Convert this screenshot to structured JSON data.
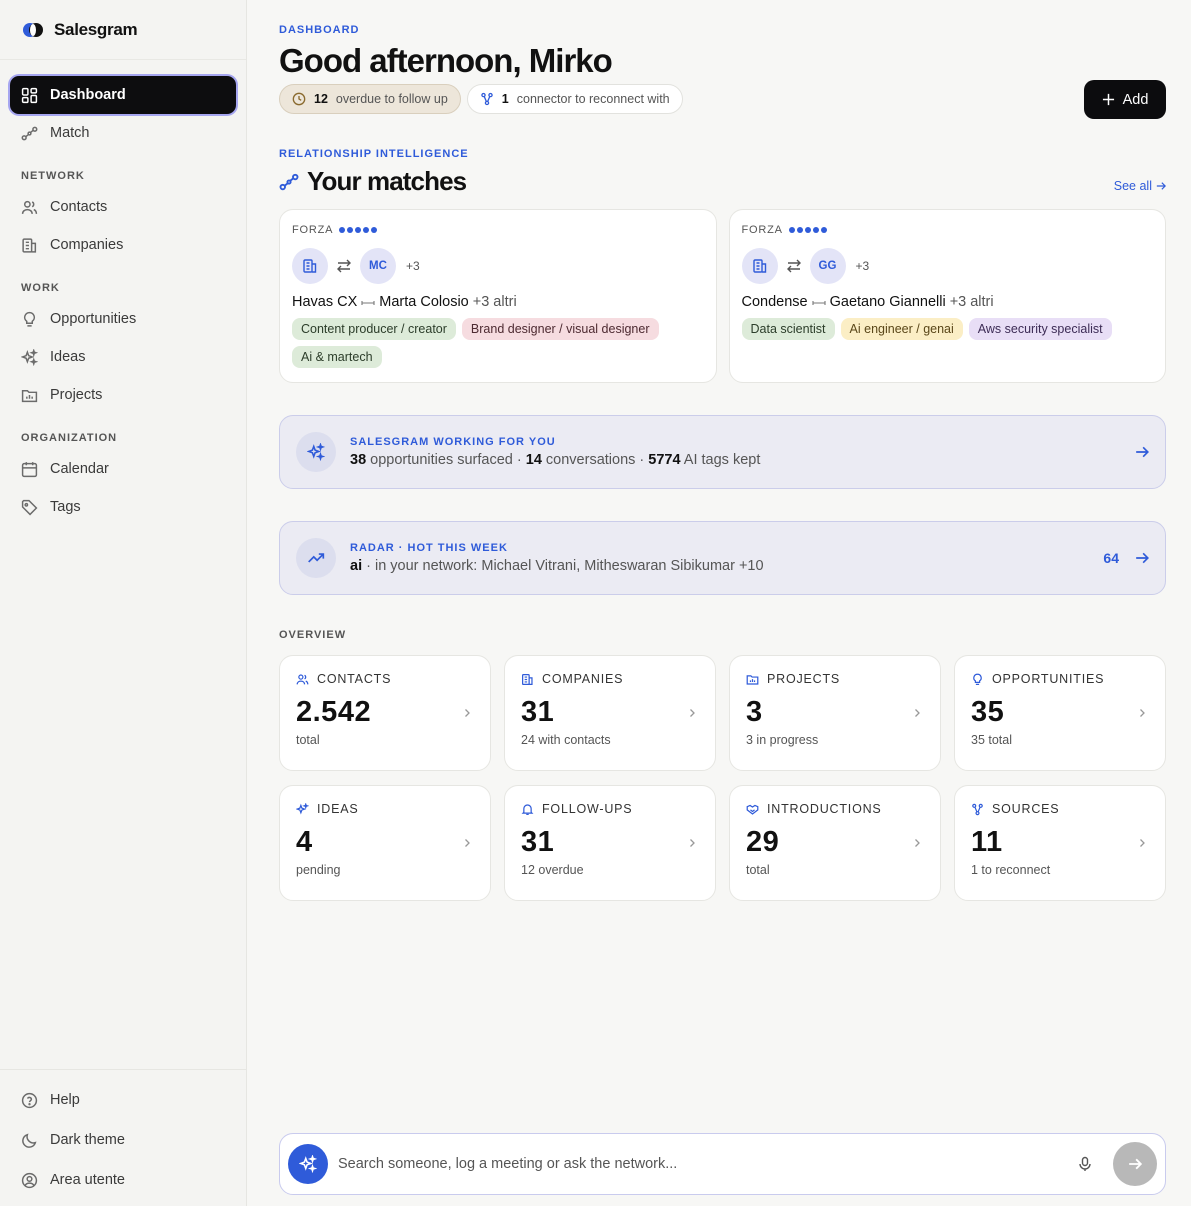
{
  "app": {
    "name": "Salesgram"
  },
  "sidebar": {
    "primary": [
      {
        "label": "Dashboard",
        "icon": "grid-icon"
      },
      {
        "label": "Match",
        "icon": "match-icon"
      }
    ],
    "network_label": "NETWORK",
    "network": [
      {
        "label": "Contacts",
        "icon": "users-icon"
      },
      {
        "label": "Companies",
        "icon": "building-icon"
      }
    ],
    "work_label": "WORK",
    "work": [
      {
        "label": "Opportunities",
        "icon": "lightbulb-icon"
      },
      {
        "label": "Ideas",
        "icon": "sparkles-icon"
      },
      {
        "label": "Projects",
        "icon": "folder-chart-icon"
      }
    ],
    "org_label": "ORGANIZATION",
    "org": [
      {
        "label": "Calendar",
        "icon": "calendar-icon"
      },
      {
        "label": "Tags",
        "icon": "tag-icon"
      }
    ],
    "bottom": [
      {
        "label": "Help",
        "icon": "help-icon"
      },
      {
        "label": "Dark theme",
        "icon": "moon-icon"
      },
      {
        "label": "Area utente",
        "icon": "user-circle-icon"
      }
    ]
  },
  "header": {
    "eyebrow": "DASHBOARD",
    "title": "Good afternoon, Mirko",
    "pill_overdue_count": "12",
    "pill_overdue_text": "overdue to follow up",
    "pill_connector_count": "1",
    "pill_connector_text": "connector to reconnect with",
    "add_label": "Add"
  },
  "matches": {
    "eyebrow": "RELATIONSHIP INTELLIGENCE",
    "title": "Your matches",
    "see_all": "See all",
    "cards": [
      {
        "strength_label": "FORZA",
        "strength": 5,
        "avatar": "MC",
        "more": "+3",
        "company": "Havas CX",
        "person": "Marta Colosio",
        "others": "+3 altri",
        "tags": [
          {
            "text": "Content producer / creator",
            "color": "green"
          },
          {
            "text": "Brand designer / visual designer",
            "color": "pink"
          },
          {
            "text": "Ai & martech",
            "color": "green"
          }
        ]
      },
      {
        "strength_label": "FORZA",
        "strength": 5,
        "avatar": "GG",
        "more": "+3",
        "company": "Condense",
        "person": "Gaetano Giannelli",
        "others": "+3 altri",
        "tags": [
          {
            "text": "Data scientist",
            "color": "green"
          },
          {
            "text": "Ai engineer / genai",
            "color": "yellow"
          },
          {
            "text": "Aws security specialist",
            "color": "purple"
          }
        ]
      }
    ]
  },
  "working": {
    "eyebrow": "SALESGRAM WORKING FOR YOU",
    "opps": "38",
    "opps_text": "opportunities surfaced",
    "sep": "·",
    "convs": "14",
    "convs_text": "conversations",
    "tags": "5774",
    "tags_text": "AI tags kept"
  },
  "radar": {
    "eyebrow": "RADAR · HOT THIS WEEK",
    "topic": "ai",
    "text": "· in your network: Michael Vitrani, Mitheswaran Sibikumar +10",
    "count": "64"
  },
  "overview": {
    "label": "OVERVIEW",
    "stats": [
      {
        "label": "CONTACTS",
        "value": "2.542",
        "sub": "total",
        "icon": "users-icon"
      },
      {
        "label": "COMPANIES",
        "value": "31",
        "sub": "24 with contacts",
        "icon": "building-icon"
      },
      {
        "label": "PROJECTS",
        "value": "3",
        "sub": "3 in progress",
        "icon": "folder-chart-icon"
      },
      {
        "label": "OPPORTUNITIES",
        "value": "35",
        "sub": "35 total",
        "icon": "lightbulb-icon"
      },
      {
        "label": "IDEAS",
        "value": "4",
        "sub": "pending",
        "icon": "sparkles-icon"
      },
      {
        "label": "FOLLOW-UPS",
        "value": "31",
        "sub": "12 overdue",
        "icon": "bell-icon"
      },
      {
        "label": "INTRODUCTIONS",
        "value": "29",
        "sub": "total",
        "icon": "handshake-icon"
      },
      {
        "label": "SOURCES",
        "value": "11",
        "sub": "1 to reconnect",
        "icon": "connector-icon"
      }
    ]
  },
  "chat": {
    "placeholder": "Search someone, log a meeting or ask the network..."
  },
  "colors": {
    "accent": "#2f5bd9",
    "active_nav": "#0d0d0f",
    "banner_bg": "#ebebf3"
  }
}
